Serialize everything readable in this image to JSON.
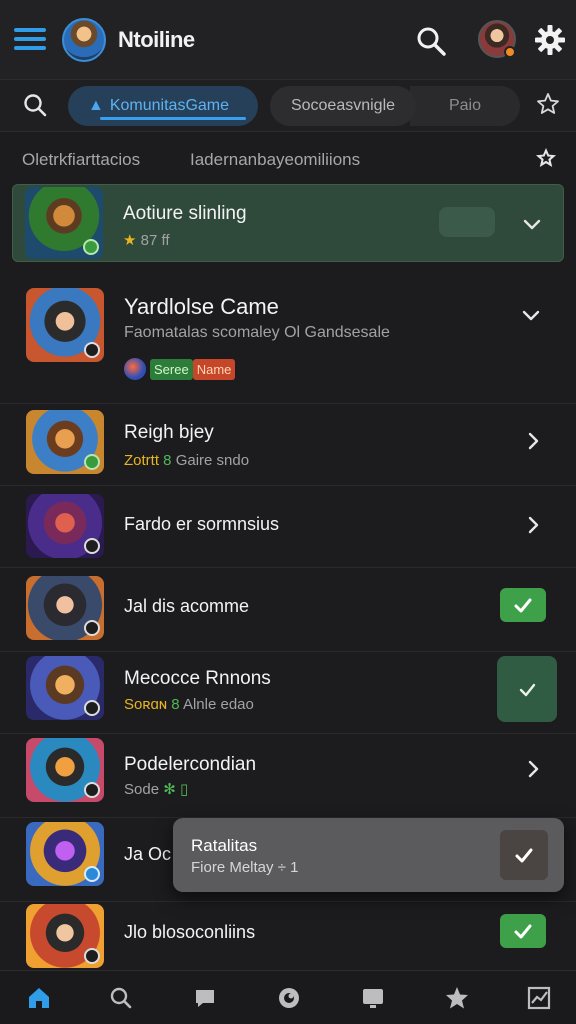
{
  "app": {
    "title": "Ntoiline"
  },
  "filter": {
    "active_chip": "KomunitasGame",
    "chip_2": "Socoeasvnigle",
    "chip_3": "Paio"
  },
  "sort": {
    "left": "Oletrkfiarttacios",
    "right": "Iadernanbayeomiliions"
  },
  "list": [
    {
      "title": "Aotiure slinling",
      "sub_stars": "★",
      "sub": " 87 ff",
      "action": "chevron-down",
      "highlight": true
    },
    {
      "title": "Yardlolse Came",
      "sub": "Faomatalas scomaley Ol Gandsesale",
      "tag_green": "Seree",
      "tag_orange": "Name",
      "action": "chevron-down"
    },
    {
      "title": "Reigh bjey",
      "sub_stars": "Zotrtt",
      "sub_green": " 8",
      "sub": " Gaire sndo",
      "action": "chevron-right"
    },
    {
      "title": "Fardo er sormnsius",
      "action": "chevron-right"
    },
    {
      "title": "Jal dis acomme",
      "action": "check"
    },
    {
      "title": "Mecocce Rnnons",
      "sub_stars": "Soʀɑɴ",
      "sub_green": " 8",
      "sub": " Alnle edao",
      "action": "check-big"
    },
    {
      "title": "Podelercondian",
      "sub": "Sode",
      "sub_green": " ✻ ▯",
      "action": "chevron-right"
    },
    {
      "title": "Ja Oc",
      "action": "none"
    },
    {
      "title": "Jlo blosoconliins",
      "action": "check"
    }
  ],
  "toast": {
    "title": "Ratalitas",
    "sub": "Fiore Meltay ÷ 1"
  },
  "colors": {
    "accent": "#2f9de8",
    "green": "#3fa04a",
    "highlight": "#2f4a3a",
    "background": "#1c1c1e"
  },
  "icons": {
    "menu": "hamburger-icon",
    "search": "search-icon",
    "settings": "gear-icon",
    "star": "star-icon",
    "home": "home-icon",
    "chat": "chat-icon",
    "explore": "explore-icon",
    "screen": "screen-icon",
    "stats": "stats-icon"
  }
}
